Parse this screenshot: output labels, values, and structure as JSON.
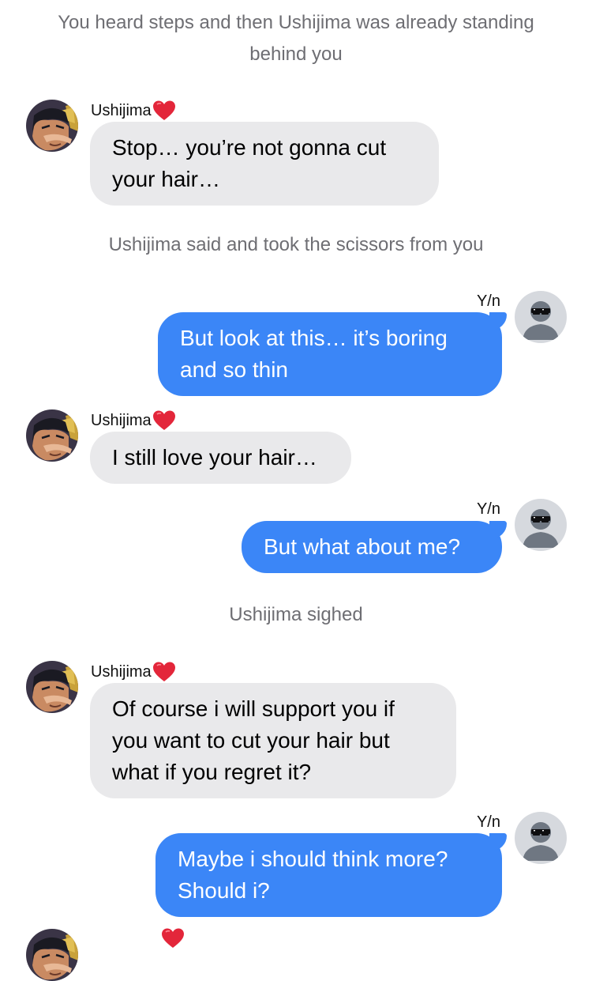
{
  "conversation": {
    "narration_1": "You heard steps and then Ushijima was already standing behind you",
    "narration_2": "Ushijima said and took the scissors from you",
    "narration_3": "Ushijima sighed",
    "messages": [
      {
        "sender": "Ushijima",
        "side": "left",
        "text": "Stop… you’re not gonna cut your hair…"
      },
      {
        "sender": "Y/n",
        "side": "right",
        "text": "But look at this… it’s boring and so thin"
      },
      {
        "sender": "Ushijima",
        "side": "left",
        "text": "I still love your hair…"
      },
      {
        "sender": "Y/n",
        "side": "right",
        "text": "But what about me?"
      },
      {
        "sender": "Ushijima",
        "side": "left",
        "text": "Of course i will support you if you want to cut your hair but what if you regret it?"
      },
      {
        "sender": "Y/n",
        "side": "right",
        "text": "Maybe i should think more? Should i?"
      }
    ]
  },
  "icons": {
    "heart": "red-heart-emoji",
    "ushijima_avatar": "anime-character-avatar",
    "yn_avatar": "sunglasses-default-avatar"
  },
  "colors": {
    "incoming_bubble": "#e9e9eb",
    "outgoing_bubble": "#3b86f7",
    "narration_text": "#6e6e73",
    "heart": "#e3263a"
  }
}
